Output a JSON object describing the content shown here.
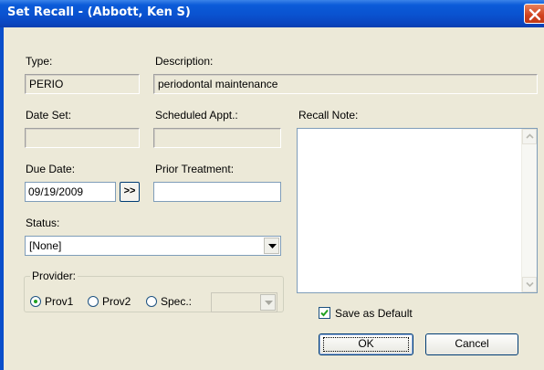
{
  "window": {
    "title": "Set Recall - (Abbott, Ken S)"
  },
  "labels": {
    "type": "Type:",
    "description": "Description:",
    "date_set": "Date Set:",
    "scheduled_appt": "Scheduled Appt.:",
    "recall_note": "Recall Note:",
    "due_date": "Due Date:",
    "prior_treatment": "Prior Treatment:",
    "status": "Status:",
    "provider": "Provider:"
  },
  "fields": {
    "type_value": "PERIO",
    "description_value": "periodontal maintenance",
    "date_set_value": "",
    "scheduled_appt_value": "",
    "due_date_value": "09/19/2009",
    "prior_treatment_value": "",
    "recall_note_value": "",
    "status_value": "[None]",
    "spec_value": ""
  },
  "buttons": {
    "due_date_next": ">>",
    "ok": "OK",
    "cancel": "Cancel"
  },
  "provider_options": [
    {
      "label": "Prov1",
      "checked": true
    },
    {
      "label": "Prov2",
      "checked": false
    },
    {
      "label": "Spec.:",
      "checked": false
    }
  ],
  "save_as_default": {
    "label": "Save as Default",
    "checked": true
  },
  "colors": {
    "titlebar": "#0a52cf",
    "dialog_bg": "#ece9d8",
    "close_button": "#d0421e"
  }
}
